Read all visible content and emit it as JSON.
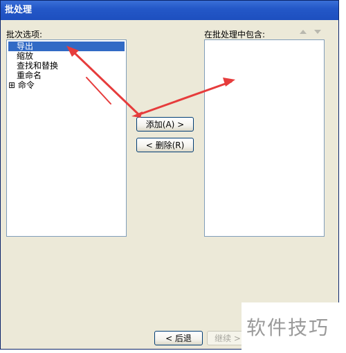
{
  "window": {
    "title": "批处理"
  },
  "left_panel": {
    "label": "批次选项:",
    "items": [
      {
        "label": "导出"
      },
      {
        "label": "缩放"
      },
      {
        "label": "查找和替换"
      },
      {
        "label": "重命名"
      },
      {
        "label": "命令",
        "expander": "⊞"
      }
    ]
  },
  "right_panel": {
    "label": "在批处理中包含:"
  },
  "buttons": {
    "add": "添加(A) >",
    "remove": "< 删除(R)",
    "back": "< 后退",
    "continue": "继续 >"
  },
  "watermark": {
    "text": "软件技巧"
  },
  "colors": {
    "title_bar": "#2458c8",
    "selection": "#316ac5",
    "annotation_arrow": "#e63c3c"
  }
}
